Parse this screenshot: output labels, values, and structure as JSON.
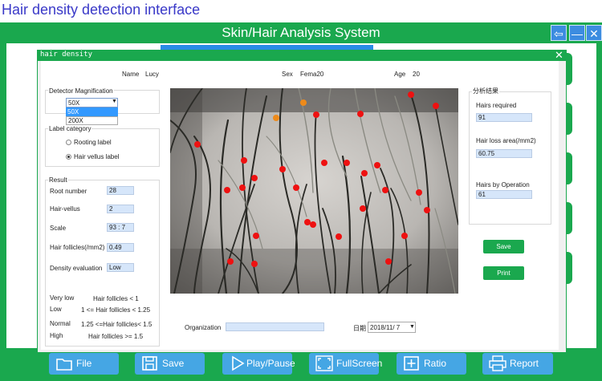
{
  "page_title": "Hair density detection interface",
  "app": {
    "title": "Skin/Hair Analysis System",
    "window_controls": [
      "back-arrow",
      "minimize",
      "close"
    ]
  },
  "dialog": {
    "title": "hair density",
    "patient": {
      "name_label": "Name",
      "name_value": "Lucy",
      "sex_label": "Sex",
      "sex_value": "Fema20",
      "age_label": "Age",
      "age_value": "20"
    },
    "magnification": {
      "label": "Detector Magnification",
      "selected": "50X",
      "options": [
        "50X",
        "200X"
      ]
    },
    "label_category": {
      "label": "Label category",
      "options": [
        "Rooting label",
        "Hair vellus label"
      ],
      "selected": "Hair vellus label"
    },
    "result": {
      "label": "Result",
      "rows": [
        {
          "label": "Root number",
          "value": "28"
        },
        {
          "label": "Hair-vellus",
          "value": "2"
        },
        {
          "label": "Scale",
          "value": "93 : 7"
        },
        {
          "label": "Hair follicles(/mm2)",
          "value": "0.49"
        },
        {
          "label": "Density evaluation",
          "value": "Low"
        }
      ]
    },
    "legend": [
      {
        "level": "Very low",
        "rule": "Hair follicles < 1"
      },
      {
        "level": "Low",
        "rule": "1 <= Hair follicles < 1.25"
      },
      {
        "level": "Normal",
        "rule": "1.25 <=Hair follicles< 1.5"
      },
      {
        "level": "High",
        "rule": "Hair follicles >= 1.5"
      }
    ],
    "analysis": {
      "label": "分析结果",
      "hairs_required_label": "Hairs required",
      "hairs_required_value": "91",
      "hair_loss_label": "Hair loss area(/mm2)",
      "hair_loss_value": "60.75",
      "hairs_by_op_label": "Hairs by Operation",
      "hairs_by_op_value": "61"
    },
    "save_label": "Save",
    "print_label": "Print",
    "organization_label": "Organization",
    "organization_value": "",
    "date_label": "日期",
    "date_value": "2018/11/  7"
  },
  "toolbar": {
    "items": [
      {
        "label": "File",
        "icon": "folder-icon"
      },
      {
        "label": "Save",
        "icon": "save-icon"
      },
      {
        "label": "Play/Pause",
        "icon": "play-icon"
      },
      {
        "label": "FullScreen",
        "icon": "fullscreen-icon"
      },
      {
        "label": "Ratio",
        "icon": "ratio-icon"
      },
      {
        "label": "Report",
        "icon": "printer-icon"
      }
    ]
  },
  "colors": {
    "accent_green": "#1aa84e",
    "toolbar_blue": "#45a6e4",
    "title_blue": "#3a39c8",
    "field_blue": "#d6e6fa",
    "marker_red": "#ee1111",
    "marker_orange": "#ee8a1a"
  }
}
